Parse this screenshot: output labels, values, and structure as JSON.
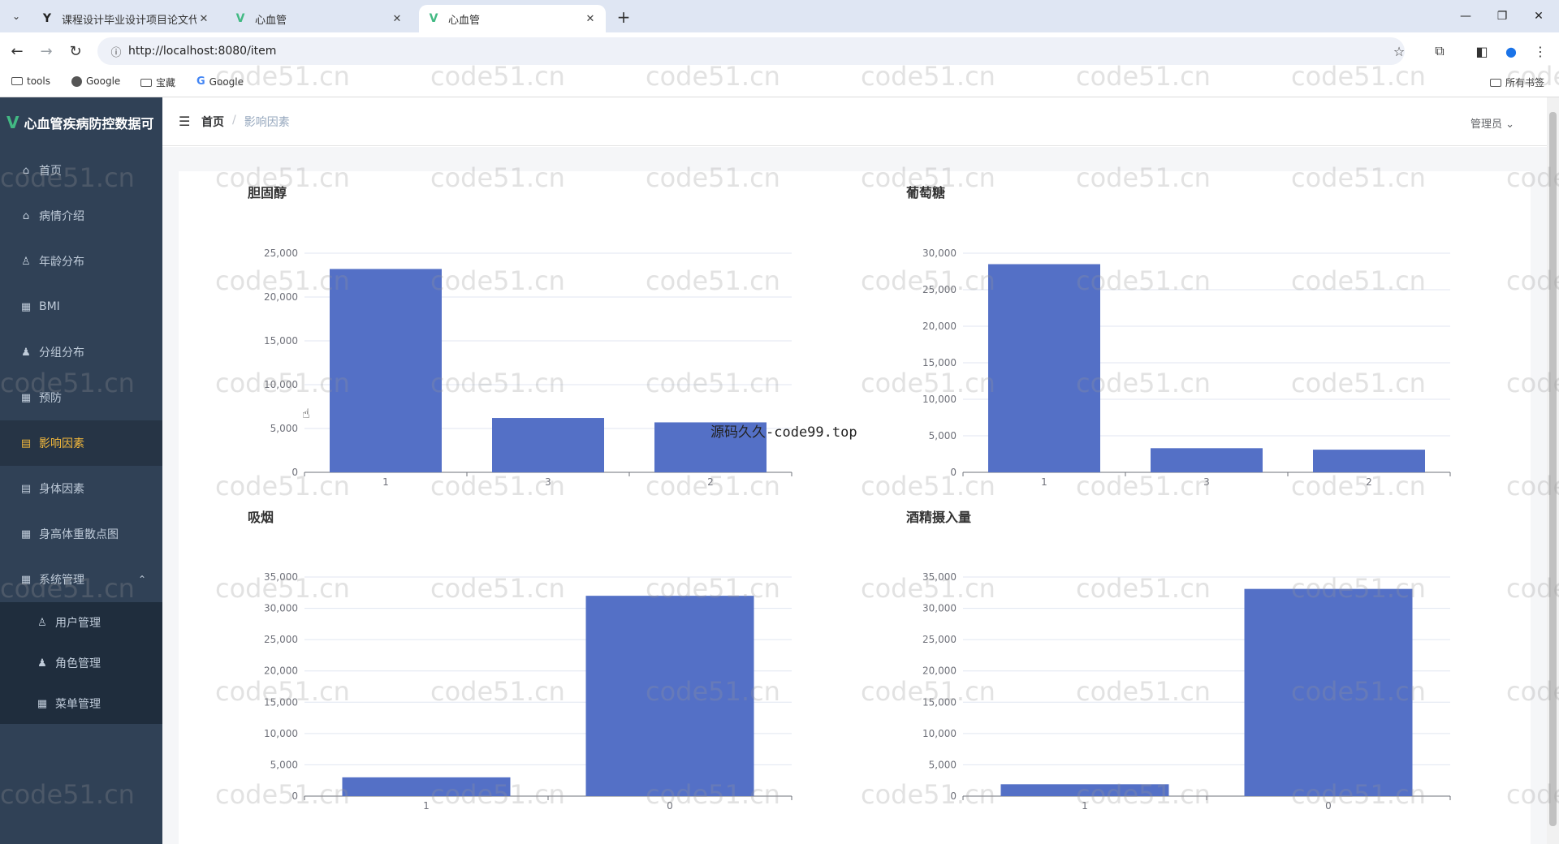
{
  "browser": {
    "tabs": [
      {
        "title": "课程设计毕业设计项目论文代写",
        "icon": "vue-icon",
        "active": false
      },
      {
        "title": "心血管",
        "icon": "vue-icon",
        "active": false
      },
      {
        "title": "心血管",
        "icon": "vue-icon",
        "active": true
      }
    ],
    "url": "http://localhost:8080/item",
    "bookmarks": [
      {
        "label": "tools",
        "icon": "folder-icon"
      },
      {
        "label": "Google",
        "icon": "globe-icon"
      },
      {
        "label": "宝藏",
        "icon": "folder-icon"
      },
      {
        "label": "Google",
        "icon": "google-icon"
      }
    ],
    "all_bookmarks": "所有书签"
  },
  "app": {
    "title": "心血管疾病防控数据可",
    "menu": [
      {
        "label": "首页",
        "icon": "home-icon"
      },
      {
        "label": "病情介绍",
        "icon": "home-icon"
      },
      {
        "label": "年龄分布",
        "icon": "user-icon"
      },
      {
        "label": "BMI",
        "icon": "grid-icon"
      },
      {
        "label": "分组分布",
        "icon": "user-icon"
      },
      {
        "label": "预防",
        "icon": "grid-icon"
      },
      {
        "label": "影响因素",
        "icon": "document-icon",
        "active": true
      },
      {
        "label": "身体因素",
        "icon": "document-icon"
      },
      {
        "label": "身高体重散点图",
        "icon": "grid-icon"
      },
      {
        "label": "系统管理",
        "icon": "grid-icon",
        "expanded": true
      }
    ],
    "submenu": [
      {
        "label": "用户管理",
        "icon": "user-icon"
      },
      {
        "label": "角色管理",
        "icon": "user-icon"
      },
      {
        "label": "菜单管理",
        "icon": "grid-icon"
      }
    ],
    "breadcrumb": {
      "home": "首页",
      "separator": "/",
      "current": "影响因素"
    },
    "user": "管理员"
  },
  "watermark": "code51.cn",
  "overlay_text": "源码久久-code99.top",
  "colors": {
    "bar": "#5470c6",
    "sidebar": "#304156",
    "active_menu_text": "#f4b93c"
  },
  "chart_data": [
    {
      "type": "bar",
      "title": "胆固醇",
      "categories": [
        "1",
        "3",
        "2"
      ],
      "values": [
        23200,
        6200,
        5700
      ],
      "ylim": [
        0,
        25000
      ],
      "ticks": [
        0,
        5000,
        10000,
        15000,
        20000,
        25000
      ],
      "tick_labels": [
        "0",
        "5,000",
        "10,000",
        "15,000",
        "20,000",
        "25,000"
      ]
    },
    {
      "type": "bar",
      "title": "葡萄糖",
      "categories": [
        "1",
        "3",
        "2"
      ],
      "values": [
        28500,
        3300,
        3100
      ],
      "ylim": [
        0,
        30000
      ],
      "ticks": [
        0,
        5000,
        10000,
        15000,
        20000,
        25000,
        30000
      ],
      "tick_labels": [
        "0",
        "5,000",
        "10,000",
        "15,000",
        "20,000",
        "25,000",
        "30,000"
      ]
    },
    {
      "type": "bar",
      "title": "吸烟",
      "categories": [
        "1",
        "0"
      ],
      "values": [
        3000,
        32000
      ],
      "ylim": [
        0,
        35000
      ],
      "ticks": [
        0,
        5000,
        10000,
        15000,
        20000,
        25000,
        30000,
        35000
      ],
      "tick_labels": [
        "0",
        "5,000",
        "10,000",
        "15,000",
        "20,000",
        "25,000",
        "30,000",
        "35,000"
      ]
    },
    {
      "type": "bar",
      "title": "酒精摄入量",
      "categories": [
        "1",
        "0"
      ],
      "values": [
        1900,
        33100
      ],
      "ylim": [
        0,
        35000
      ],
      "ticks": [
        0,
        5000,
        10000,
        15000,
        20000,
        25000,
        30000,
        35000
      ],
      "tick_labels": [
        "0",
        "5,000",
        "10,000",
        "15,000",
        "20,000",
        "25,000",
        "30,000",
        "35,000"
      ]
    }
  ]
}
